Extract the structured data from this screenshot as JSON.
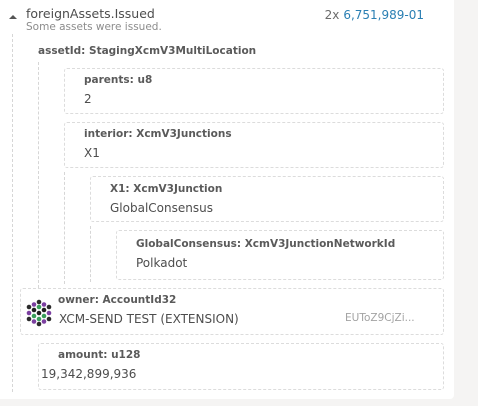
{
  "event": {
    "title": "foreignAssets.Issued",
    "subtitle": "Some assets were issued.",
    "count": "2x",
    "ref": "6,751,989-01"
  },
  "fields": {
    "asset_id": {
      "label": "assetId: StagingXcmV3MultiLocation"
    },
    "parents": {
      "label": "parents: u8",
      "value": "2"
    },
    "interior": {
      "label": "interior: XcmV3Junctions",
      "value": "X1"
    },
    "x1": {
      "label": "X1: XcmV3Junction",
      "value": "GlobalConsensus"
    },
    "global_consensus": {
      "label": "GlobalConsensus: XcmV3JunctionNetworkId",
      "value": "Polkadot"
    },
    "owner": {
      "label": "owner: AccountId32",
      "name": "XCM-SEND TEST (EXTENSION)",
      "address": "EUToZ9CjZi..."
    },
    "amount": {
      "label": "amount: u128",
      "value": "19,342,899,936"
    }
  },
  "icons": {
    "collapse": "chevron-up-icon",
    "avatar": "identicon-avatar"
  },
  "colors": {
    "link": "#2a7fb3",
    "background": "#f5f4f3"
  }
}
